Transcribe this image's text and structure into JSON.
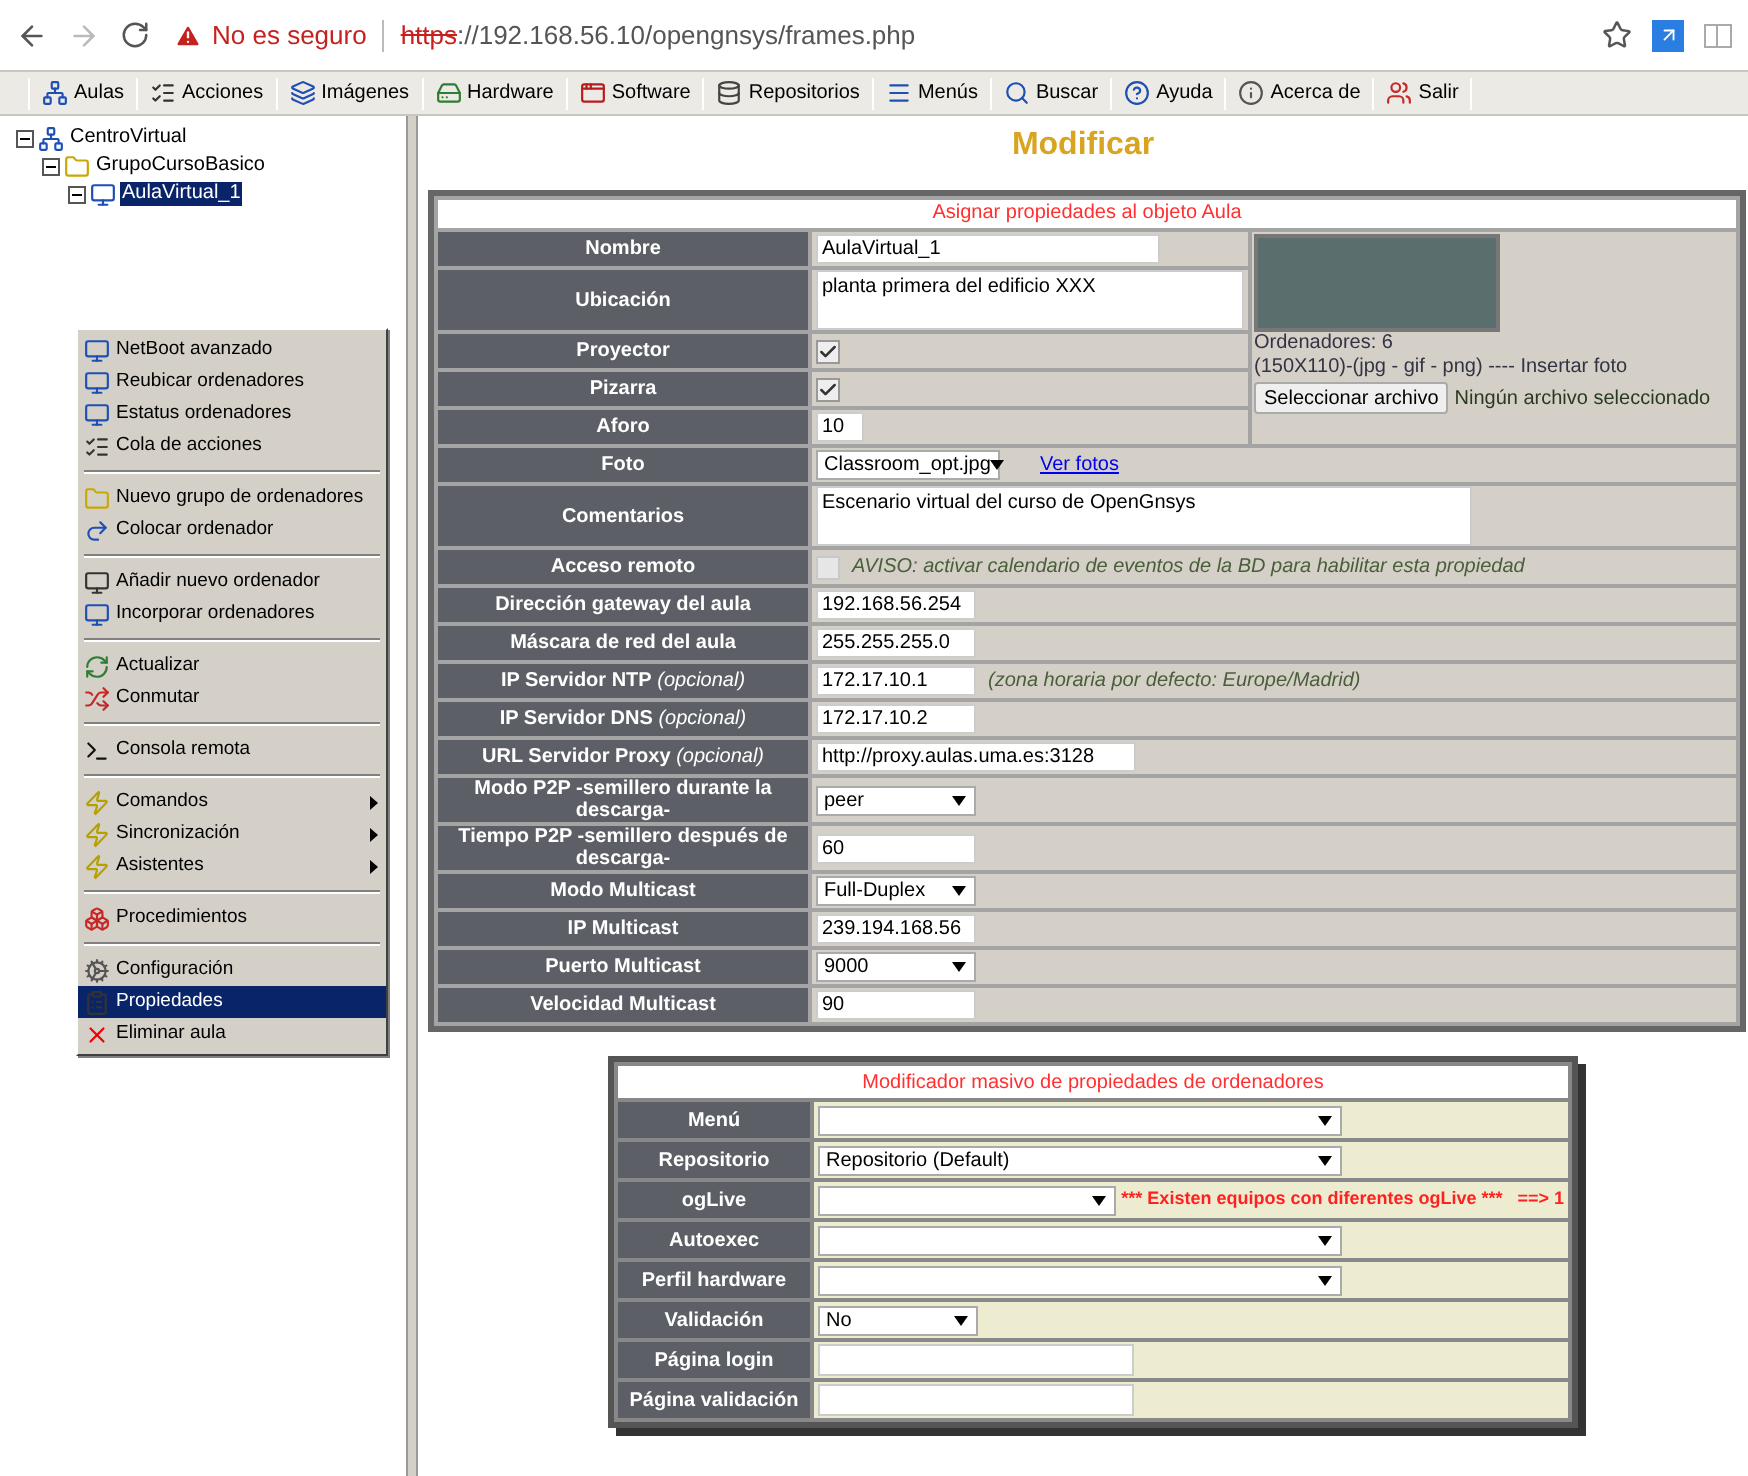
{
  "browser": {
    "security": "No es seguro",
    "url_scheme": "https",
    "url_rest": "://192.168.56.10/opengnsys/frames.php"
  },
  "toolbar": [
    "Aulas",
    "Acciones",
    "Imágenes",
    "Hardware",
    "Software",
    "Repositorios",
    "Menús",
    "Buscar",
    "Ayuda",
    "Acerca de",
    "Salir"
  ],
  "tree": [
    {
      "label": "CentroVirtual",
      "expanded": true,
      "selected": false,
      "children": [
        {
          "label": "GrupoCursoBasico",
          "expanded": true,
          "selected": false,
          "children": [
            {
              "label": "AulaVirtual_1",
              "expanded": true,
              "selected": true
            }
          ]
        }
      ]
    }
  ],
  "context_menu": [
    [
      {
        "label": "NetBoot avanzado",
        "submenu": false,
        "selected": false
      },
      {
        "label": "Reubicar ordenadores",
        "submenu": false,
        "selected": false
      },
      {
        "label": "Estatus ordenadores",
        "submenu": false,
        "selected": false
      },
      {
        "label": "Cola de acciones",
        "submenu": false,
        "selected": false
      }
    ],
    [
      {
        "label": "Nuevo grupo de ordenadores",
        "submenu": false,
        "selected": false
      },
      {
        "label": "Colocar ordenador",
        "submenu": false,
        "selected": false
      }
    ],
    [
      {
        "label": "Añadir nuevo ordenador",
        "submenu": false,
        "selected": false
      },
      {
        "label": "Incorporar ordenadores",
        "submenu": false,
        "selected": false
      }
    ],
    [
      {
        "label": "Actualizar",
        "submenu": false,
        "selected": false
      },
      {
        "label": "Conmutar",
        "submenu": false,
        "selected": false
      }
    ],
    [
      {
        "label": "Consola remota",
        "submenu": false,
        "selected": false
      }
    ],
    [
      {
        "label": "Comandos",
        "submenu": true,
        "selected": false
      },
      {
        "label": "Sincronización",
        "submenu": true,
        "selected": false
      },
      {
        "label": "Asistentes",
        "submenu": true,
        "selected": false
      }
    ],
    [
      {
        "label": "Procedimientos",
        "submenu": false,
        "selected": false
      }
    ],
    [
      {
        "label": "Configuración",
        "submenu": false,
        "selected": false
      },
      {
        "label": "Propiedades",
        "submenu": false,
        "selected": true
      },
      {
        "label": "Eliminar aula",
        "submenu": false,
        "selected": false
      }
    ]
  ],
  "page_title": "Modificar",
  "form": {
    "title": "Asignar propiedades al objeto Aula",
    "photo": {
      "computers": "Ordenadores: 6",
      "hint": "(150X110)-(jpg - gif - png) ---- Insertar foto",
      "button": "Seleccionar archivo",
      "file_status": "Ningún archivo seleccionado"
    },
    "rows": [
      {
        "label": "Nombre",
        "kind": "text",
        "value": "AulaVirtual_1"
      },
      {
        "label": "Ubicación",
        "kind": "textarea",
        "value": "planta primera del edificio XXX"
      },
      {
        "label": "Proyector",
        "kind": "checkbox",
        "checked": true,
        "disabled": false
      },
      {
        "label": "Pizarra",
        "kind": "checkbox",
        "checked": true,
        "disabled": false
      },
      {
        "label": "Aforo",
        "kind": "text",
        "value": "10"
      },
      {
        "label": "Foto",
        "kind": "select",
        "value": "Classroom_opt.jpg",
        "link": "Ver fotos"
      },
      {
        "label": "Comentarios",
        "kind": "textarea",
        "value": "Escenario virtual del curso de OpenGnsys"
      },
      {
        "label": "Acceso remoto",
        "kind": "checkbox",
        "checked": false,
        "disabled": true,
        "note": "AVISO: activar calendario de eventos de la BD para habilitar esta propiedad"
      },
      {
        "label": "Dirección gateway del aula",
        "kind": "text",
        "value": "192.168.56.254"
      },
      {
        "label": "Máscara de red del aula",
        "kind": "text",
        "value": "255.255.255.0"
      },
      {
        "label": "IP Servidor NTP",
        "label_note": "(opcional)",
        "kind": "text",
        "value": "172.17.10.1",
        "note": "(zona horaria por defecto: Europe/Madrid)"
      },
      {
        "label": "IP Servidor DNS",
        "label_note": "(opcional)",
        "kind": "text",
        "value": "172.17.10.2"
      },
      {
        "label": "URL Servidor Proxy",
        "label_note": "(opcional)",
        "kind": "text",
        "value": "http://proxy.aulas.uma.es:3128"
      },
      {
        "label": "Modo P2P -semillero durante la descarga-",
        "kind": "select",
        "value": "peer"
      },
      {
        "label": "Tiempo P2P -semillero después de descarga-",
        "kind": "text",
        "value": "60"
      },
      {
        "label": "Modo Multicast",
        "kind": "select",
        "value": "Full-Duplex"
      },
      {
        "label": "IP Multicast",
        "kind": "text",
        "value": "239.194.168.56"
      },
      {
        "label": "Puerto Multicast",
        "kind": "select",
        "value": "9000"
      },
      {
        "label": "Velocidad Multicast",
        "kind": "text",
        "value": "90"
      }
    ]
  },
  "bulk_form": {
    "title": "Modificador masivo de propiedades de ordenadores",
    "rows": [
      {
        "label": "Menú",
        "kind": "select"
      },
      {
        "label": "Repositorio",
        "kind": "select",
        "value": "Repositorio (Default)"
      },
      {
        "label": "ogLive",
        "kind": "select",
        "warning": "*** Existen equipos con diferentes ogLive ***   ==> 1"
      },
      {
        "label": "Autoexec",
        "kind": "select"
      },
      {
        "label": "Perfil hardware",
        "kind": "select"
      },
      {
        "label": "Validación",
        "kind": "select",
        "value": "No"
      },
      {
        "label": "Página login",
        "kind": "text"
      },
      {
        "label": "Página validación",
        "kind": "text"
      }
    ]
  }
}
